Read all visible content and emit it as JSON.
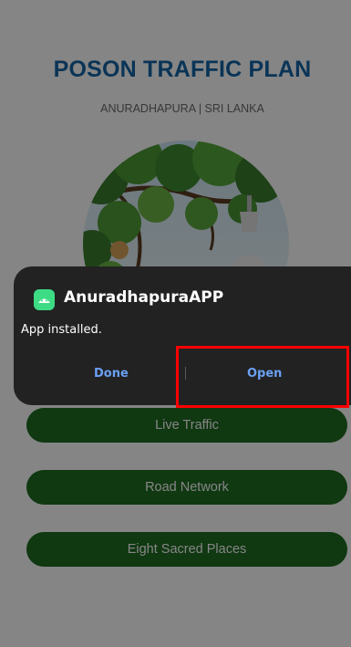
{
  "app": {
    "title": "POSON TRAFFIC PLAN",
    "subtitle": "ANURADHAPURA | SRI LANKA"
  },
  "menu": {
    "items": [
      {
        "label": "Live Traffic"
      },
      {
        "label": "Road Network"
      },
      {
        "label": "Eight Sacred Places"
      }
    ],
    "button_color": "#1f6b22"
  },
  "toast": {
    "app_name": "AnuradhapuraAPP",
    "message": "App installed.",
    "done_label": "Done",
    "open_label": "Open",
    "icon": "android-icon",
    "icon_color": "#3ddc84"
  },
  "colors": {
    "title": "#1565a6",
    "toast_bg": "#222222",
    "action_text": "#6aa0f3",
    "highlight": "#ff0000"
  }
}
